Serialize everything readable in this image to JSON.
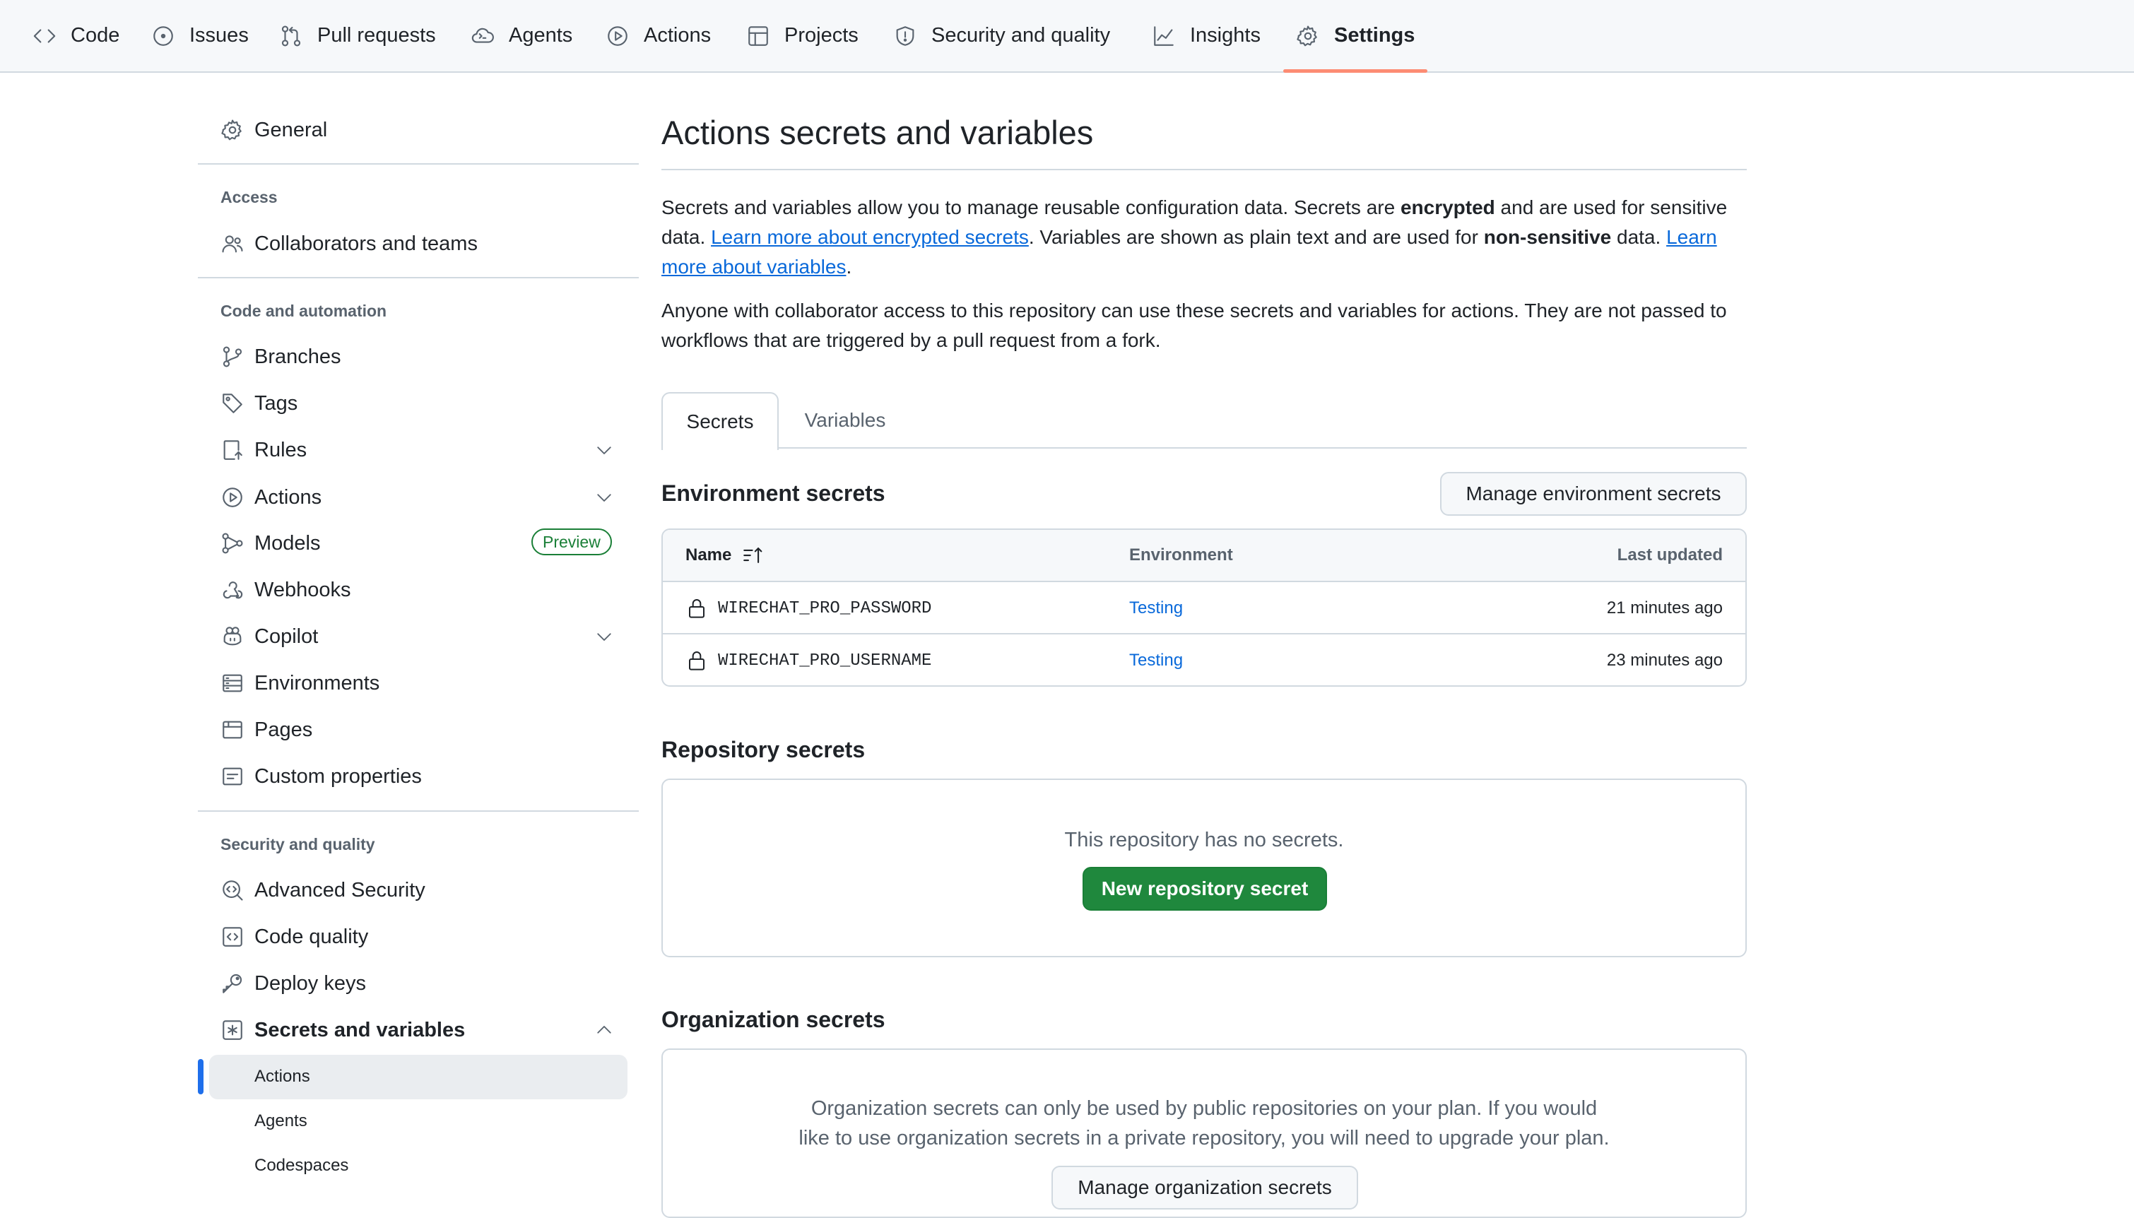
{
  "topnav": {
    "tabs": [
      {
        "label": "Code",
        "icon": "code-icon"
      },
      {
        "label": "Issues",
        "icon": "issue-opened-icon"
      },
      {
        "label": "Pull requests",
        "icon": "git-pull-request-icon"
      },
      {
        "label": "Agents",
        "icon": "agent-icon"
      },
      {
        "label": "Actions",
        "icon": "play-icon"
      },
      {
        "label": "Projects",
        "icon": "table-icon"
      },
      {
        "label": "Security and quality",
        "icon": "shield-icon"
      },
      {
        "label": "Insights",
        "icon": "graph-icon"
      },
      {
        "label": "Settings",
        "icon": "gear-icon"
      }
    ],
    "selected": "Settings"
  },
  "sidebar": {
    "general": "General",
    "access_header": "Access",
    "collaborators": "Collaborators and teams",
    "code_header": "Code and automation",
    "branches": "Branches",
    "tags": "Tags",
    "rules": "Rules",
    "actions": "Actions",
    "models": "Models",
    "models_badge": "Preview",
    "webhooks": "Webhooks",
    "copilot": "Copilot",
    "environments": "Environments",
    "pages": "Pages",
    "custom_properties": "Custom properties",
    "security_header": "Security and quality",
    "advanced_security": "Advanced Security",
    "code_quality": "Code quality",
    "deploy_keys": "Deploy keys",
    "secrets_and_variables": "Secrets and variables",
    "sub_actions": "Actions",
    "sub_agents": "Agents",
    "sub_codespaces": "Codespaces",
    "active_sub": "Actions"
  },
  "main": {
    "title": "Actions secrets and variables",
    "intro": {
      "t1": "Secrets and variables allow you to manage reusable configuration data. Secrets are ",
      "b1": "encrypted",
      "t2": " and are used for sensitive data. ",
      "link1": "Learn more about encrypted secrets",
      "t3": ". Variables are shown as plain text and are used for ",
      "b2": "non-sensitive",
      "t4": " data. ",
      "link2": "Learn more about variables",
      "t5": "."
    },
    "access_note": "Anyone with collaborator access to this repository can use these secrets and variables for actions. They are not passed to workflows that are triggered by a pull request from a fork.",
    "tabs": {
      "secrets": "Secrets",
      "variables": "Variables",
      "active": "Secrets"
    },
    "env_secrets": {
      "title": "Environment secrets",
      "manage_button": "Manage environment secrets",
      "columns": {
        "name": "Name",
        "environment": "Environment",
        "last_updated": "Last updated"
      },
      "rows": [
        {
          "name": "WIRECHAT_PRO_PASSWORD",
          "environment": "Testing",
          "updated": "21 minutes ago"
        },
        {
          "name": "WIRECHAT_PRO_USERNAME",
          "environment": "Testing",
          "updated": "23 minutes ago"
        }
      ]
    },
    "repo_secrets": {
      "title": "Repository secrets",
      "empty": "This repository has no secrets.",
      "new_button": "New repository secret"
    },
    "org_secrets": {
      "title": "Organization secrets",
      "note_line1": "Organization secrets can only be used by public repositories on your plan. If you would",
      "note_line2": "like to use organization secrets in a private repository, you will need to upgrade your plan.",
      "manage_button": "Manage organization secrets"
    }
  }
}
